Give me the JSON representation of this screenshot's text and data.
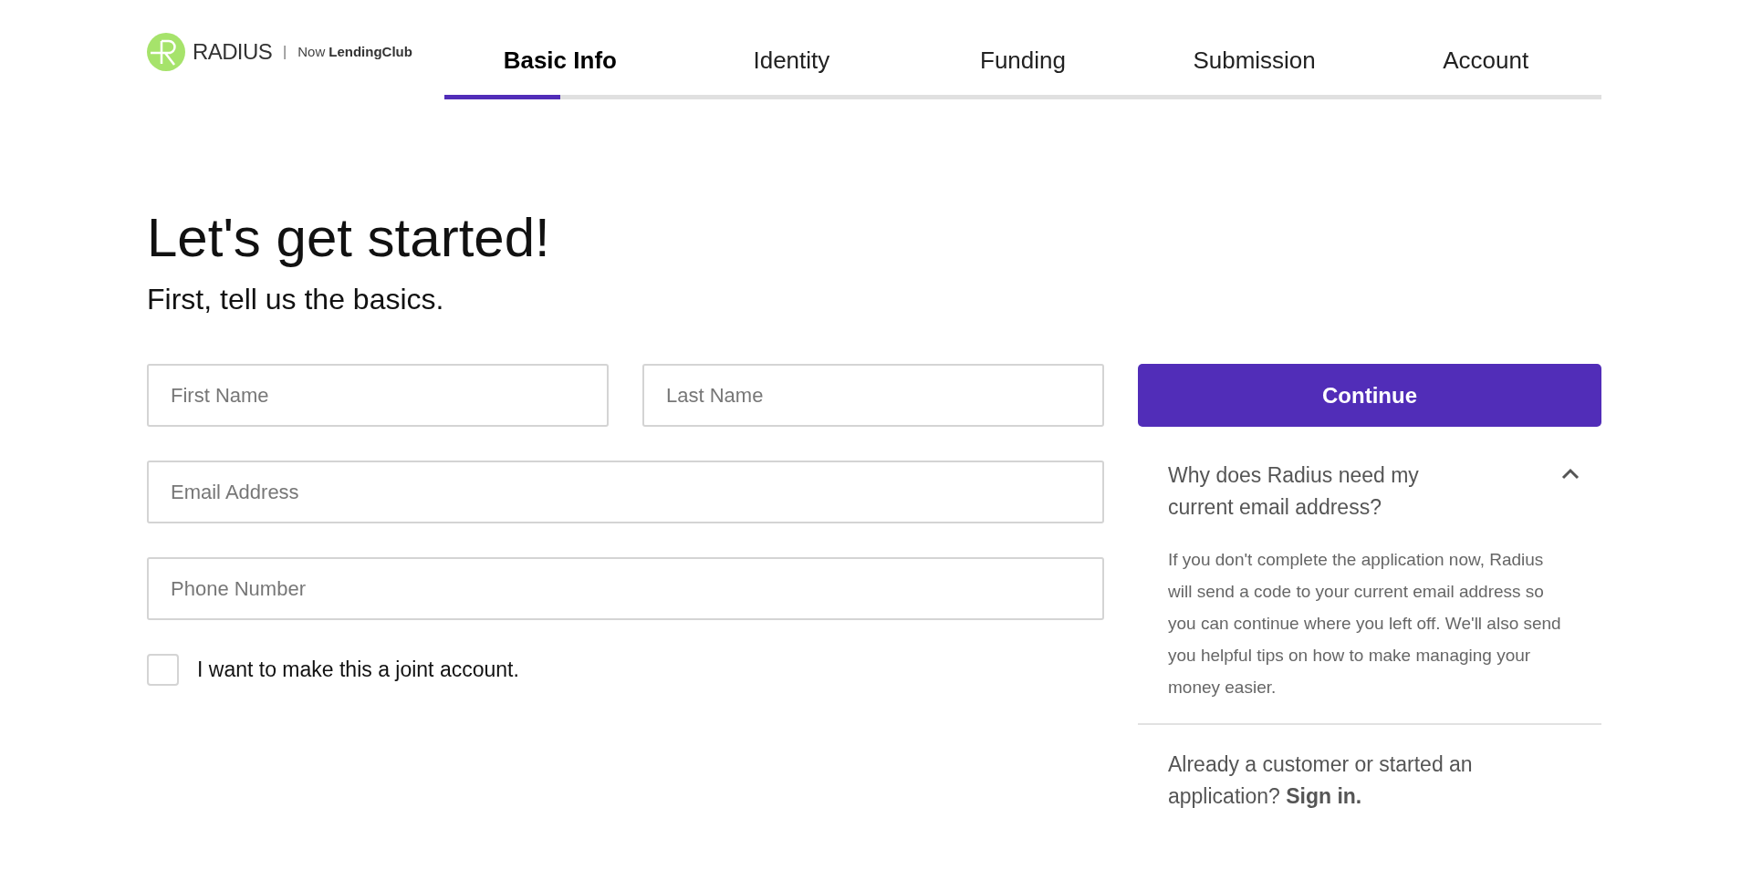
{
  "header": {
    "brand": "RADIUS",
    "separator": "|",
    "tagline_prefix": "Now",
    "tagline_brand": "LendingClub"
  },
  "steps": [
    {
      "label": "Basic Info",
      "selected": true
    },
    {
      "label": "Identity",
      "selected": false
    },
    {
      "label": "Funding",
      "selected": false
    },
    {
      "label": "Submission",
      "selected": false
    },
    {
      "label": "Account",
      "selected": false
    }
  ],
  "progress": {
    "level": 0.1
  },
  "title": "Let's get started!",
  "subtitle": "First, tell us the basics.",
  "form": {
    "fields": [
      {
        "placeholder": "First Name"
      },
      {
        "placeholder": "Last Name"
      },
      {
        "placeholder": "Email Address"
      },
      {
        "placeholder": "Phone Number"
      }
    ],
    "joint_account": {
      "label": "I want to make this a joint account.",
      "checked": false
    }
  },
  "continue_button": "Continue",
  "faq": {
    "question": "Why does Radius need my current email address?",
    "expanded": true,
    "answer": "If you don't complete the application now, Radius will send a code to your current email address so you can continue where you left off. We'll also send you helpful tips on how to make managing your money easier."
  },
  "sign_in": {
    "text": "Already a customer or started an application?",
    "link": "Sign in."
  }
}
